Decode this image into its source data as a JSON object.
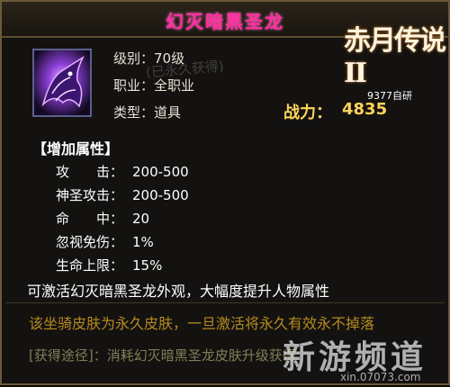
{
  "item": {
    "name": "幻灭暗黑圣龙",
    "level_line": "级别：70级",
    "class_line": "职业：全职业",
    "type_line": "类型：道具",
    "stamp": "(已永久获得)"
  },
  "power": {
    "label": "战力：",
    "value": "4835"
  },
  "logo": {
    "title": "赤月传说II",
    "subtitle": "9377自研"
  },
  "section": {
    "heading": "【增加属性】"
  },
  "attributes": [
    {
      "name": "攻　　击：",
      "value": "200-500"
    },
    {
      "name": "神圣攻击：",
      "value": "200-500"
    },
    {
      "name": "命　　中：",
      "value": "20"
    },
    {
      "name": "忽视免伤：",
      "value": "1%"
    },
    {
      "name": "生命上限：",
      "value": "15%"
    }
  ],
  "description": "可激活幻灭暗黑圣龙外观，大幅度提升人物属性",
  "note": "该坐骑皮肤为永久皮肤，一旦激活将永久有效永不掉落",
  "source": "[获得途径]：消耗幻灭暗黑圣龙皮肤升级获得",
  "watermark": {
    "main": "新游频道",
    "url": "xin.07073.com"
  },
  "colors": {
    "title": "#ff2fa0",
    "power": "#ffd45a",
    "note": "#b58a1e",
    "border": "#6b5a3a"
  }
}
